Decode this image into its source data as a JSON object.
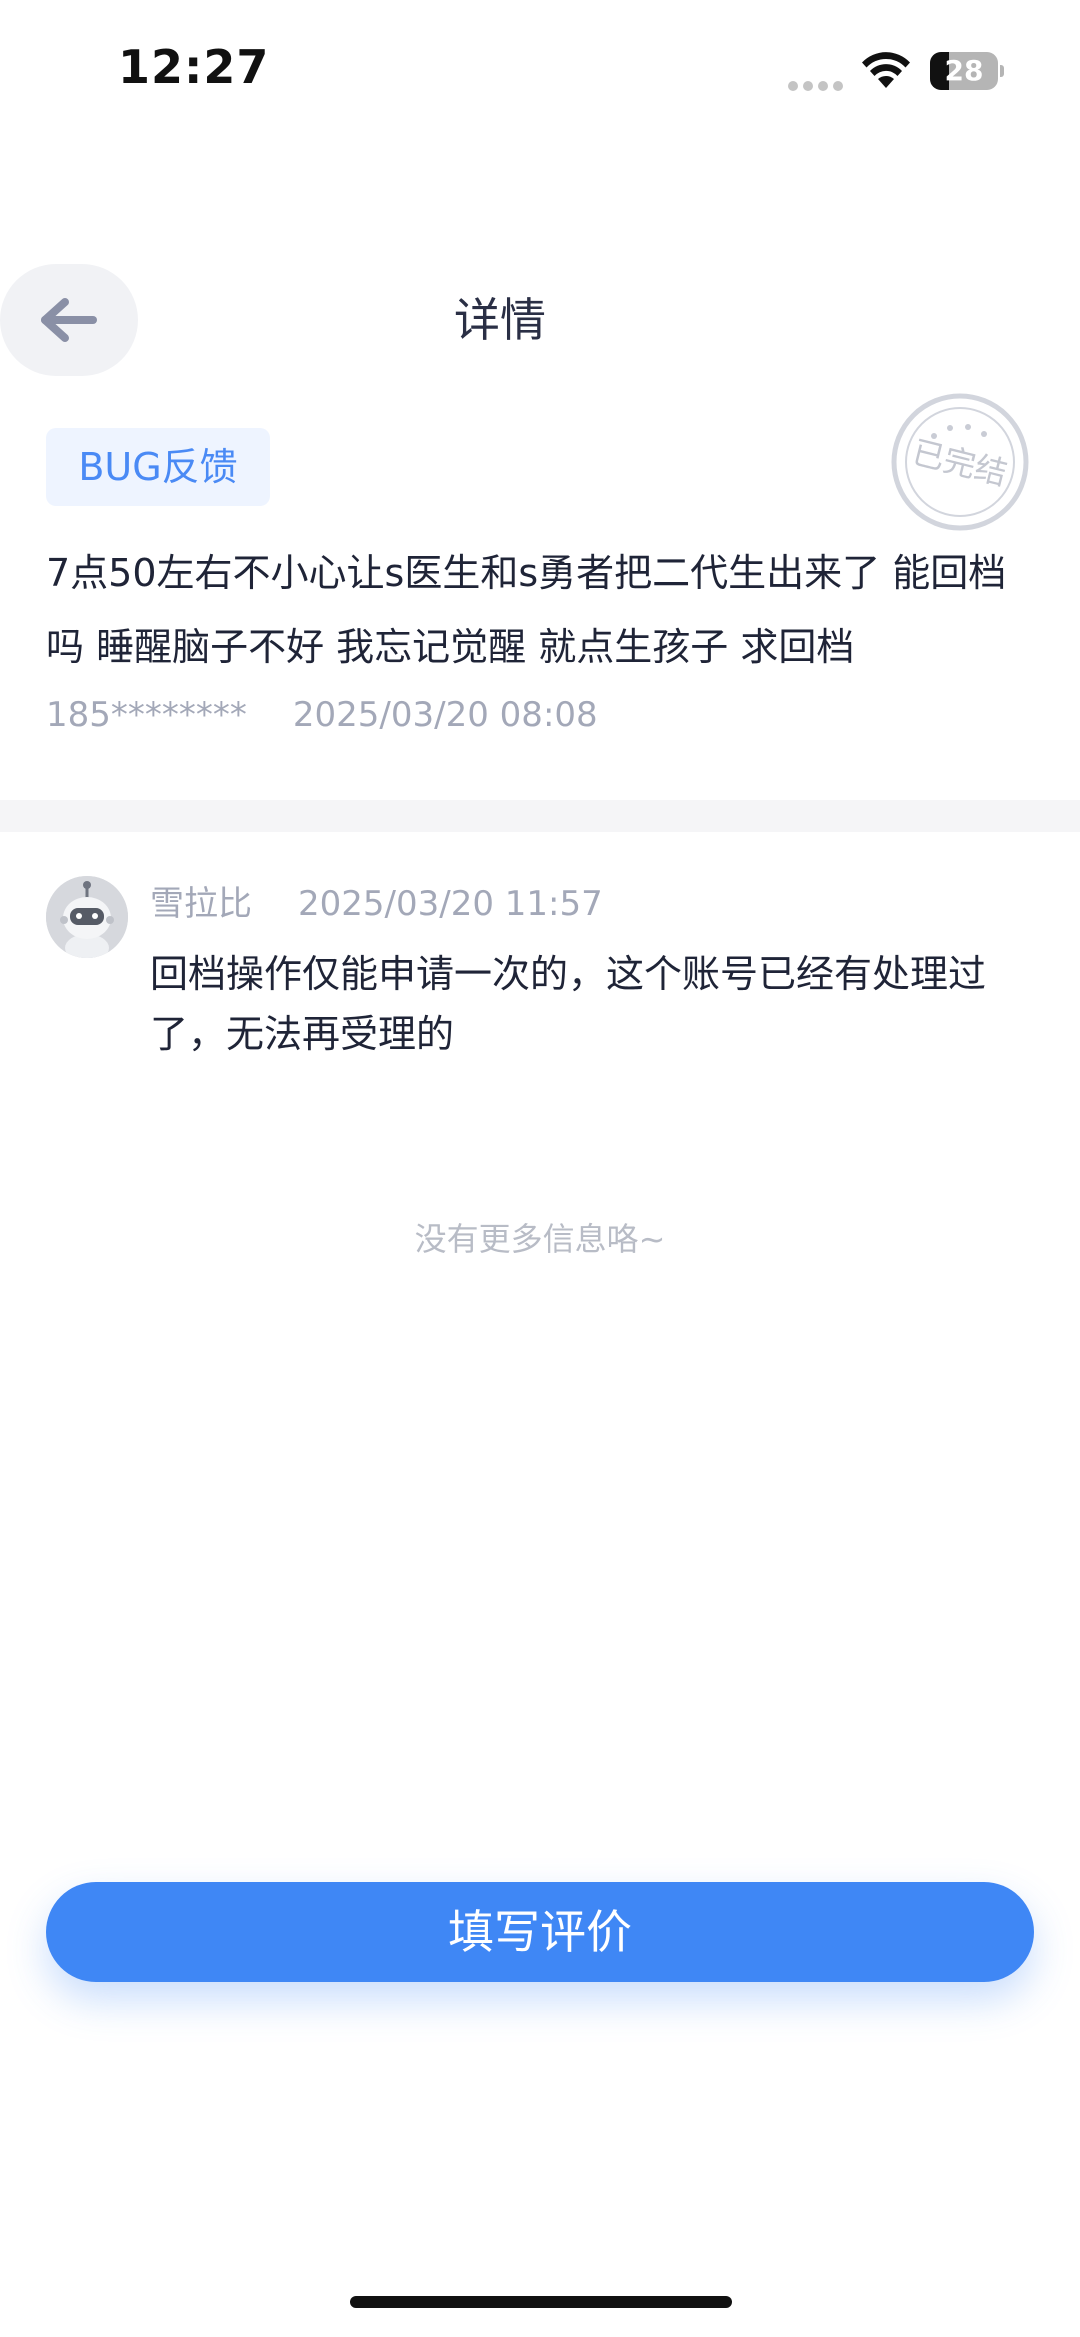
{
  "status_bar": {
    "time": "12:27",
    "battery": "28",
    "battery_level": 0.28
  },
  "header": {
    "title": "详情",
    "back_icon": "arrow-left-icon"
  },
  "feedback": {
    "category": "BUG反馈",
    "status_stamp": "已完结",
    "content": "7点50左右不小心让s医生和s勇者把二代生出来了 能回档吗 睡醒脑子不好 我忘记觉醒 就点生孩子 求回档",
    "user": "185********",
    "time": "2025/03/20 08:08"
  },
  "reply": {
    "author": "雪拉比",
    "time": "2025/03/20 11:57",
    "content": "回档操作仅能申请一次的，这个账号已经有处理过了，无法再受理的",
    "avatar_icon": "robot-avatar-icon"
  },
  "footer": {
    "no_more_text": "没有更多信息咯~",
    "review_button": "填写评价"
  },
  "colors": {
    "accent": "#3f87f5",
    "tag_bg": "#eef4ff",
    "tag_text": "#4a8af5",
    "meta_text": "#a3a8b8"
  }
}
